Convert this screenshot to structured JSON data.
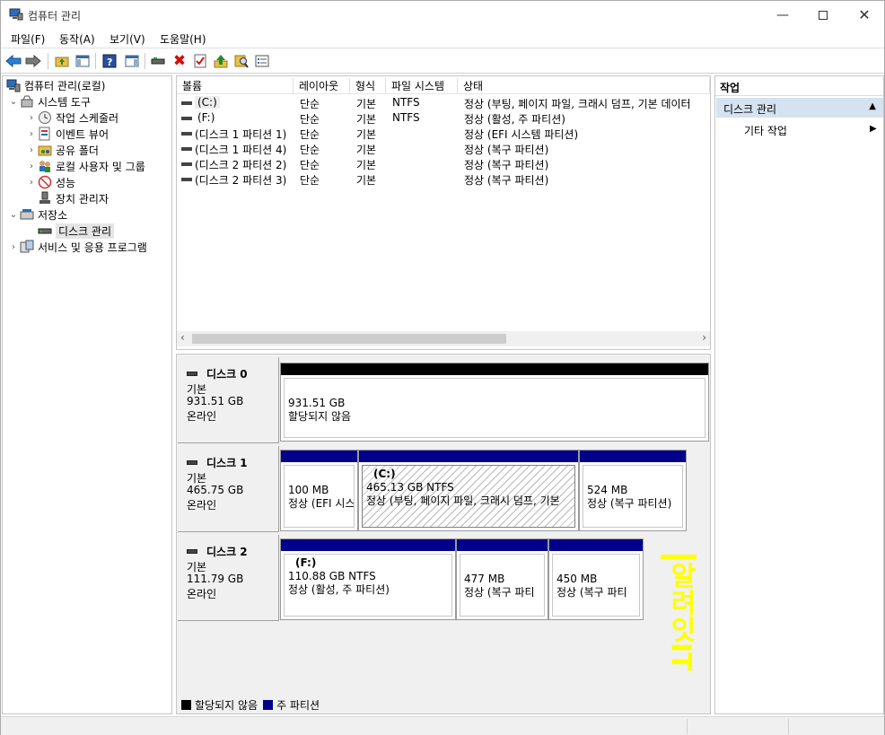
{
  "window": {
    "title": "컴퓨터 관리"
  },
  "menu": [
    "파일(F)",
    "동작(A)",
    "보기(V)",
    "도움말(H)"
  ],
  "tree": {
    "root": "컴퓨터 관리(로컬)",
    "system_tools": "시스템 도구",
    "task_scheduler": "작업 스케줄러",
    "event_viewer": "이벤트 뷰어",
    "shared_folders": "공유 폴더",
    "local_users": "로컬 사용자 및 그룹",
    "performance": "성능",
    "device_manager": "장치 관리자",
    "storage": "저장소",
    "disk_management": "디스크 관리",
    "services": "서비스 및 응용 프로그램"
  },
  "volume_list": {
    "headers": [
      "볼륨",
      "레이아웃",
      "형식",
      "파일 시스템",
      "상태"
    ],
    "rows": [
      [
        "(C:)",
        "단순",
        "기본",
        "NTFS",
        "정상 (부팅, 페이지 파일, 크래시 덤프, 기본 데이터"
      ],
      [
        "(F:)",
        "단순",
        "기본",
        "NTFS",
        "정상 (활성, 주 파티션)"
      ],
      [
        "(디스크 1 파티션 1)",
        "단순",
        "기본",
        "",
        "정상 (EFI 시스템 파티션)"
      ],
      [
        "(디스크 1 파티션 4)",
        "단순",
        "기본",
        "",
        "정상 (복구 파티션)"
      ],
      [
        "(디스크 2 파티션 2)",
        "단순",
        "기본",
        "",
        "정상 (복구 파티션)"
      ],
      [
        "(디스크 2 파티션 3)",
        "단순",
        "기본",
        "",
        "정상 (복구 파티션)"
      ]
    ]
  },
  "disks": {
    "d0": {
      "name": "디스크 0",
      "type": "기본",
      "size": "931.51 GB",
      "state": "온라인",
      "p1": {
        "size": "931.51 GB",
        "status": "할당되지 않음"
      }
    },
    "d1": {
      "name": "디스크 1",
      "type": "기본",
      "size": "465.75 GB",
      "state": "온라인",
      "p1": {
        "size": "100 MB",
        "status": "정상 (EFI 시스"
      },
      "p2": {
        "label": "(C:)",
        "size": "465.13 GB NTFS",
        "status": "정상 (부팅, 페이지 파일, 크래시 덤프, 기본"
      },
      "p3": {
        "size": "524 MB",
        "status": "정상 (복구 파티션)"
      }
    },
    "d2": {
      "name": "디스크 2",
      "type": "기본",
      "size": "111.79 GB",
      "state": "온라인",
      "p1": {
        "label": "(F:)",
        "size": "110.88 GB NTFS",
        "status": "정상 (활성, 주 파티션)"
      },
      "p2": {
        "size": "477 MB",
        "status": "정상 (복구 파티"
      },
      "p3": {
        "size": "450 MB",
        "status": "정상 (복구 파티"
      }
    }
  },
  "legend": {
    "unallocated": "할당되지 않음",
    "primary": "주 파티션"
  },
  "actions": {
    "header": "작업",
    "section": "디스크 관리",
    "item": "기타 작업"
  },
  "colors": {
    "unallocated": "#000000",
    "primary": "#00008b",
    "selected_section": "#d5e2ef",
    "watermark": "#ffff00"
  },
  "watermark": {
    "text": "알려잇IT"
  }
}
